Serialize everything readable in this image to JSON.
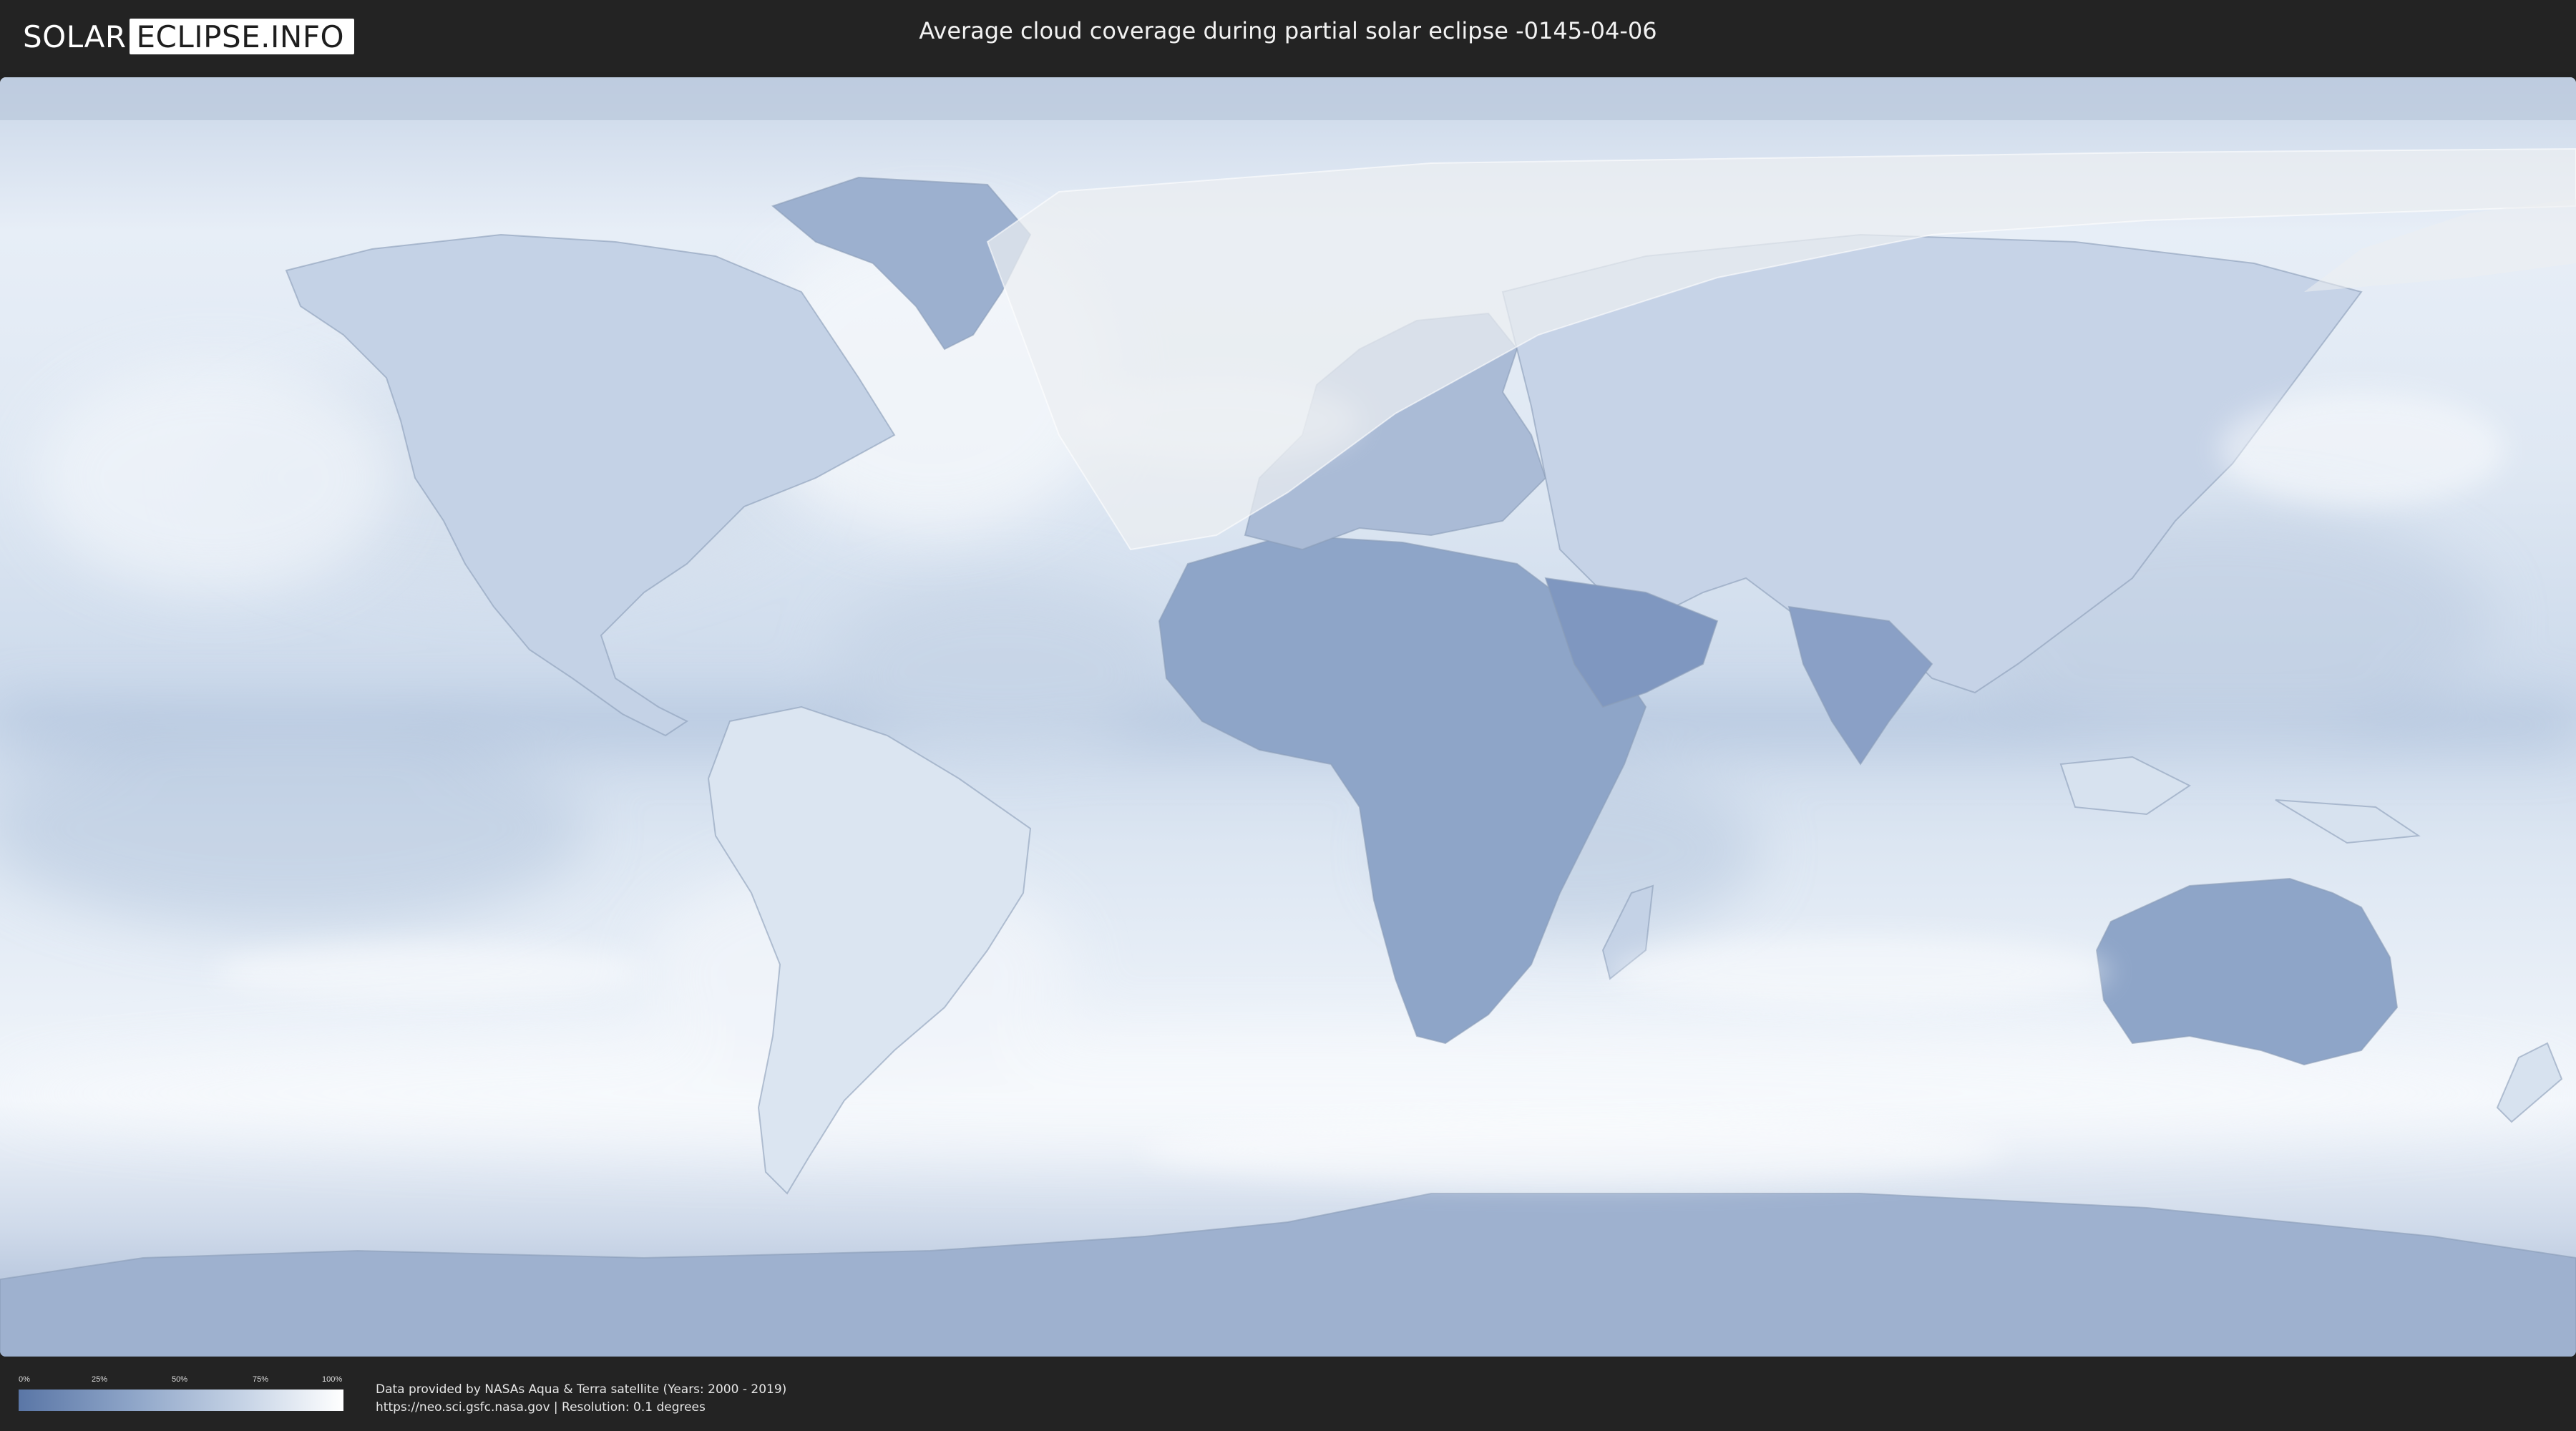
{
  "header": {
    "logo_left": "SOLAR",
    "logo_right": "ECLIPSE.INFO",
    "title": "Average cloud coverage during partial solar eclipse -0145-04-06"
  },
  "legend": {
    "ticks": [
      "0%",
      "25%",
      "50%",
      "75%",
      "100%"
    ],
    "colors": {
      "low": "#5a76a6",
      "high": "#ffffff"
    }
  },
  "footer": {
    "credit_line1": "Data provided by NASAs Aqua & Terra satellite (Years: 2000 - 2019)",
    "credit_line2": "https://neo.sci.gsfc.nasa.gov | Resolution: 0.1 degrees"
  },
  "colors": {
    "background": "#232323",
    "ocean_cloud": "#dfe8f3",
    "clear_sky": "#6f89b6",
    "eclipse_zone": "#e9ebee"
  }
}
